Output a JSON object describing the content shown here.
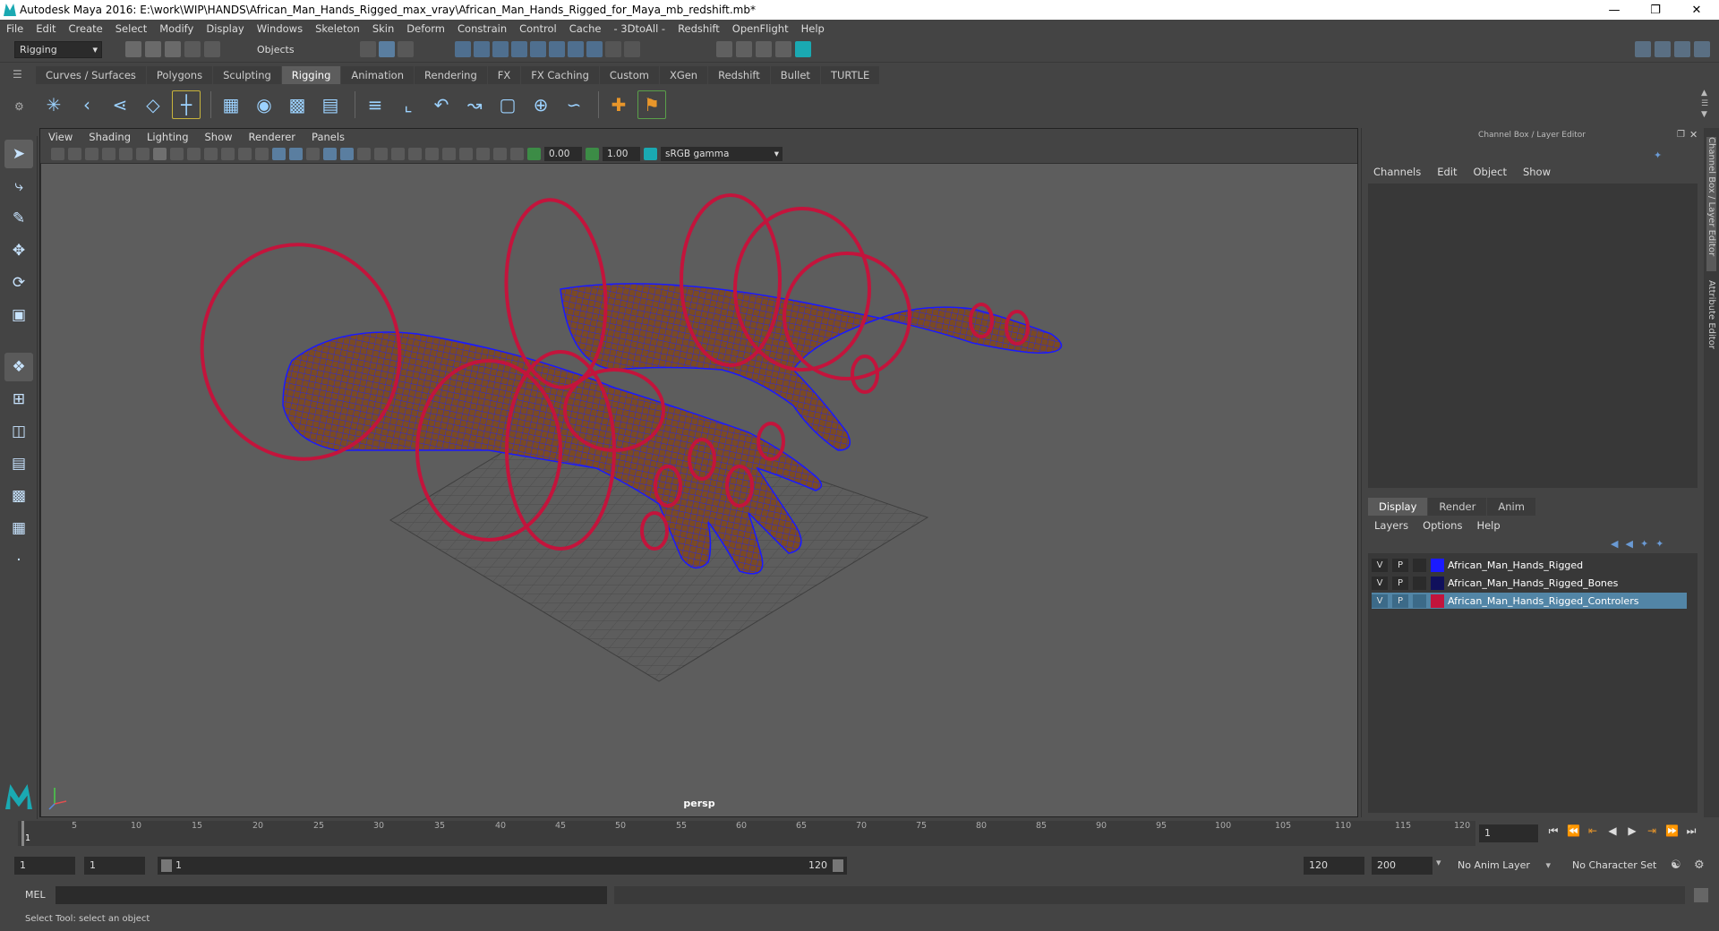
{
  "window": {
    "title": "Autodesk Maya 2016: E:\\work\\WIP\\HANDS\\African_Man_Hands_Rigged_max_vray\\African_Man_Hands_Rigged_for_Maya_mb_redshift.mb*"
  },
  "menubar": [
    "File",
    "Edit",
    "Create",
    "Select",
    "Modify",
    "Display",
    "Windows",
    "Skeleton",
    "Skin",
    "Deform",
    "Constrain",
    "Control",
    "Cache",
    "- 3DtoAll -",
    "Redshift",
    "OpenFlight",
    "Help"
  ],
  "statusline": {
    "menuset": "Rigging",
    "selection_mode": "Objects"
  },
  "shelf_tabs": [
    "Curves / Surfaces",
    "Polygons",
    "Sculpting",
    "Rigging",
    "Animation",
    "Rendering",
    "FX",
    "FX Caching",
    "Custom",
    "XGen",
    "Redshift",
    "Bullet",
    "TURTLE"
  ],
  "active_shelf": "Rigging",
  "viewport": {
    "menu": [
      "View",
      "Shading",
      "Lighting",
      "Show",
      "Renderer",
      "Panels"
    ],
    "exposure": "0.00",
    "gamma": "1.00",
    "color_space": "sRGB gamma",
    "camera_label": "persp"
  },
  "channel_box": {
    "header": "Channel Box / Layer Editor",
    "menu": [
      "Channels",
      "Edit",
      "Object",
      "Show"
    ]
  },
  "layer_editor": {
    "tabs": [
      "Display",
      "Render",
      "Anim"
    ],
    "active_tab": "Display",
    "menu": [
      "Layers",
      "Options",
      "Help"
    ],
    "layers": [
      {
        "v": "V",
        "p": "P",
        "color": "#1a1aff",
        "name": "African_Man_Hands_Rigged",
        "selected": false
      },
      {
        "v": "V",
        "p": "P",
        "color": "#10105c",
        "name": "African_Man_Hands_Rigged_Bones",
        "selected": false
      },
      {
        "v": "V",
        "p": "P",
        "color": "#c3143c",
        "name": "African_Man_Hands_Rigged_Controlers",
        "selected": true
      }
    ]
  },
  "side_tabs": [
    "Channel Box / Layer Editor",
    "Attribute Editor"
  ],
  "timeline": {
    "ticks": [
      "1",
      "5",
      "10",
      "15",
      "20",
      "25",
      "30",
      "35",
      "40",
      "45",
      "50",
      "55",
      "60",
      "65",
      "70",
      "75",
      "80",
      "85",
      "90",
      "95",
      "100",
      "105",
      "110",
      "115",
      "120"
    ],
    "current_frame": "1"
  },
  "range": {
    "start": "1",
    "playback_start": "1",
    "slider_start": "1",
    "slider_end": "120",
    "playback_end": "120",
    "end": "200",
    "anim_layer": "No Anim Layer",
    "character_set": "No Character Set"
  },
  "command_line": {
    "label": "MEL"
  },
  "help_line": "Select Tool: select an object",
  "colors": {
    "controllers": "#c3143c",
    "wireframe": "#1a1aff",
    "skin": "#7a4a25",
    "selection": "#5285a6"
  }
}
